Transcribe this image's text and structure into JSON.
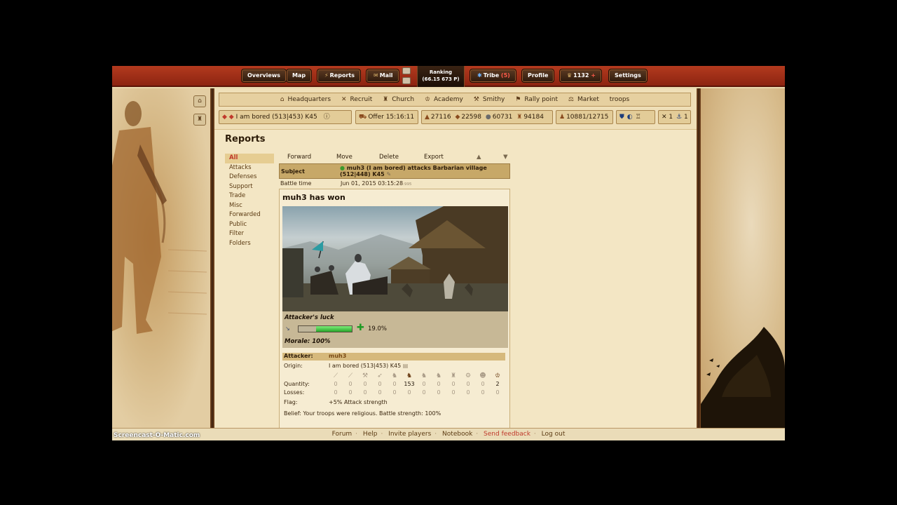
{
  "topbar": {
    "overviews": "Overviews",
    "map": "Map",
    "reports": "Reports",
    "mail": "Mail",
    "ranking_label": "Ranking",
    "ranking_value": "(66.15 673 P)",
    "tribe": "Tribe",
    "tribe_count": "(5)",
    "profile": "Profile",
    "premium": "1132",
    "settings": "Settings"
  },
  "buildings": [
    {
      "icon": "headquarters-icon",
      "glyph": "⌂",
      "label": "Headquarters"
    },
    {
      "icon": "recruit-icon",
      "glyph": "✕",
      "label": "Recruit"
    },
    {
      "icon": "church-icon",
      "glyph": "♜",
      "label": "Church"
    },
    {
      "icon": "academy-icon",
      "glyph": "♔",
      "label": "Academy"
    },
    {
      "icon": "smithy-icon",
      "glyph": "⚒",
      "label": "Smithy"
    },
    {
      "icon": "rally-point-icon",
      "glyph": "⚑",
      "label": "Rally point"
    },
    {
      "icon": "market-icon",
      "glyph": "⚖",
      "label": "Market"
    },
    {
      "icon": "",
      "glyph": "",
      "label": "troops"
    }
  ],
  "infobar": {
    "village": "I am bored (513|453) K45",
    "offer": "Offer 15:16:11",
    "wood": "27116",
    "clay": "22598",
    "iron": "60731",
    "storage": "94184",
    "farm": "10881/12715",
    "count1": "1",
    "count2": "1"
  },
  "page": {
    "title": "Reports"
  },
  "report_menu": [
    "All",
    "Attacks",
    "Defenses",
    "Support",
    "Trade",
    "Misc",
    "Forwarded",
    "Public",
    "Filter",
    "Folders"
  ],
  "actions": [
    "Forward",
    "Move",
    "Delete",
    "Export"
  ],
  "report": {
    "subject_label": "Subject",
    "subject": "muh3 (I am bored) attacks Barbarian village (512|448) K45",
    "battle_time_label": "Battle time",
    "battle_time": "Jun 01, 2015 03:15:28",
    "battle_time_ms": ":995",
    "winner": "muh3 has won",
    "luck_title": "Attacker's luck",
    "luck_value": "19.0%",
    "luck_fraction": 0.19,
    "morale": "Morale: 100%",
    "attacker_label": "Attacker:",
    "attacker_name": "muh3",
    "origin_label": "Origin:",
    "origin": "I am bored (513|453) K45",
    "quantity_label": "Quantity:",
    "losses_label": "Losses:",
    "quantity": [
      "0",
      "0",
      "0",
      "0",
      "0",
      "153",
      "0",
      "0",
      "0",
      "0",
      "0",
      "2"
    ],
    "losses": [
      "0",
      "0",
      "0",
      "0",
      "0",
      "0",
      "0",
      "0",
      "0",
      "0",
      "0",
      "0"
    ],
    "flag_label": "Flag:",
    "flag": "+5% Attack strength",
    "belief": "Belief: Your troops were religious. Battle strength: 100%"
  },
  "footer": [
    "Forum",
    "Help",
    "Invite players",
    "Notebook",
    "Send feedback",
    "Log out"
  ],
  "watermark": "Screencast-O-Matic.com"
}
